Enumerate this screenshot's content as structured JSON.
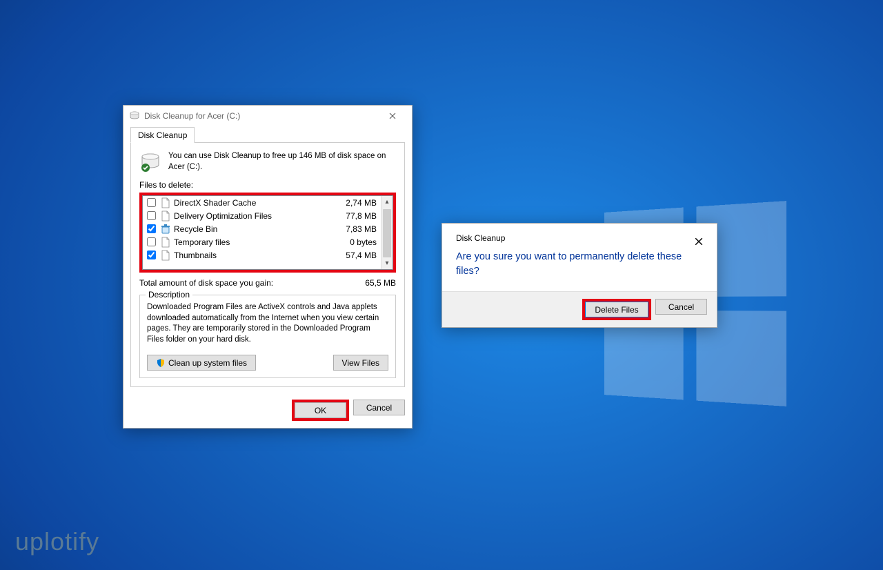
{
  "watermark": "uplotify",
  "main": {
    "title": "Disk Cleanup for Acer (C:)",
    "tab": "Disk Cleanup",
    "info": "You can use Disk Cleanup to free up 146 MB of disk space on Acer (C:).",
    "files_label": "Files to delete:",
    "items": [
      {
        "checked": false,
        "name": "DirectX Shader Cache",
        "size": "2,74 MB",
        "icon": "file"
      },
      {
        "checked": false,
        "name": "Delivery Optimization Files",
        "size": "77,8 MB",
        "icon": "file"
      },
      {
        "checked": true,
        "name": "Recycle Bin",
        "size": "7,83 MB",
        "icon": "bin"
      },
      {
        "checked": false,
        "name": "Temporary files",
        "size": "0 bytes",
        "icon": "file"
      },
      {
        "checked": true,
        "name": "Thumbnails",
        "size": "57,4 MB",
        "icon": "file"
      }
    ],
    "total_label": "Total amount of disk space you gain:",
    "total_value": "65,5 MB",
    "desc_heading": "Description",
    "desc_text": "Downloaded Program Files are ActiveX controls and Java applets downloaded automatically from the Internet when you view certain pages. They are temporarily stored in the Downloaded Program Files folder on your hard disk.",
    "cleanup_btn": "Clean up system files",
    "viewfiles_btn": "View Files",
    "ok": "OK",
    "cancel": "Cancel"
  },
  "confirm": {
    "title": "Disk Cleanup",
    "text": "Are you sure you want to permanently delete these files?",
    "delete_btn": "Delete Files",
    "cancel_btn": "Cancel"
  }
}
